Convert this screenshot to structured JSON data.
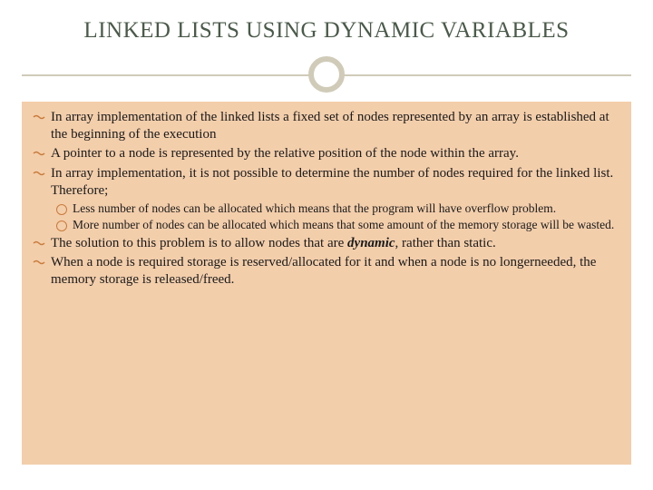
{
  "title": "LINKED LISTS USING DYNAMIC VARIABLES",
  "bullets": [
    "In array implementation of the linked lists a fixed set of nodes represented by an array is established at the beginning of the execution",
    "A pointer to a node is represented by the relative position of the node within the array.",
    "In array implementation, it is not possible to determine the number of nodes required for the linked list. Therefore;"
  ],
  "sub_bullets": [
    "Less number of nodes can be allocated which means that the program will have overflow problem.",
    "More number of nodes can be allocated which means that some amount of the memory storage will be wasted."
  ],
  "bullets2_part1": "The solution to this problem is to allow nodes that are ",
  "bullets2_bold": "dynamic",
  "bullets2_part2": ", rather than static.",
  "bullets3": "When a node is required storage is reserved/allocated for it and when a node is no longerneeded, the memory storage is released/freed."
}
